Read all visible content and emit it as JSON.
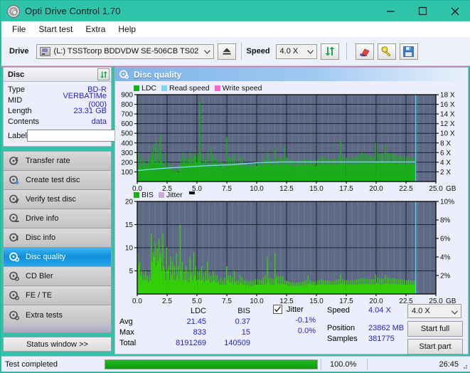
{
  "window": {
    "title": "Opti Drive Control 1.70",
    "icon": "disc-icon",
    "minimize": "minimize-icon",
    "maximize": "maximize-icon",
    "close": "close-icon"
  },
  "menu": {
    "items": [
      {
        "label": "File"
      },
      {
        "label": "Start test"
      },
      {
        "label": "Extra"
      },
      {
        "label": "Help"
      }
    ]
  },
  "toolbar": {
    "drive_label": "Drive",
    "drive_value": "(L:)  TSSTcorp BDDVDW SE-506CB TS02",
    "eject_icon": "eject-icon",
    "speed_label": "Speed",
    "speed_value": "4.0 X",
    "refresh_icon": "refresh-icon",
    "erase_icon": "eraser-icon",
    "key_icon": "key-icon",
    "save_icon": "save-icon"
  },
  "disc_panel": {
    "title": "Disc",
    "refresh_icon": "refresh-icon",
    "rows": [
      {
        "key": "Type",
        "value": "BD-R"
      },
      {
        "key": "MID",
        "value": "VERBATIMe (000)"
      },
      {
        "key": "Length",
        "value": "23.31 GB"
      },
      {
        "key": "Contents",
        "value": "data"
      }
    ],
    "label_key": "Label",
    "label_value": "",
    "label_placeholder": "",
    "disc_button_icon": "cd-icon"
  },
  "nav": {
    "items": [
      {
        "label": "Transfer rate",
        "icon": "disc-rate-icon",
        "selected": false
      },
      {
        "label": "Create test disc",
        "icon": "disc-create-icon",
        "selected": false
      },
      {
        "label": "Verify test disc",
        "icon": "disc-verify-icon",
        "selected": false
      },
      {
        "label": "Drive info",
        "icon": "drive-info-icon",
        "selected": false
      },
      {
        "label": "Disc info",
        "icon": "disc-info-icon",
        "selected": false
      },
      {
        "label": "Disc quality",
        "icon": "disc-quality-icon",
        "selected": true
      },
      {
        "label": "CD Bler",
        "icon": "cd-bler-icon",
        "selected": false
      },
      {
        "label": "FE / TE",
        "icon": "fe-te-icon",
        "selected": false
      },
      {
        "label": "Extra tests",
        "icon": "extra-tests-icon",
        "selected": false
      }
    ],
    "status_window": "Status window >>"
  },
  "main": {
    "title": "Disc quality",
    "title_icon": "disc-quality-icon"
  },
  "stats": {
    "col_ldc": "LDC",
    "col_bis": "BIS",
    "jitter_label": "Jitter",
    "jitter_checked": true,
    "rows": [
      {
        "name": "Avg",
        "ldc": "21.45",
        "bis": "0.37",
        "jitter": "-0.1%"
      },
      {
        "name": "Max",
        "ldc": "833",
        "bis": "15",
        "jitter": "0.0%"
      },
      {
        "name": "Total",
        "ldc": "8191269",
        "bis": "140509",
        "jitter": ""
      }
    ],
    "speed_label": "Speed",
    "speed_value": "4.04 X",
    "position_label": "Position",
    "position_value": "23862 MB",
    "samples_label": "Samples",
    "samples_value": "381775",
    "speed_select": "4.0 X",
    "start_full": "Start full",
    "start_part": "Start part"
  },
  "statusbar": {
    "text": "Test completed",
    "progress_pct_label": "100.0%",
    "progress_value": 100,
    "elapsed": "26:45"
  },
  "colors": {
    "titlebar": "#2ec4aa",
    "ldc_green": "#17b017",
    "bis_green": "#31d400",
    "read_speed": "#7fd6f0",
    "write_speed": "#ff66cc",
    "jitter": "#c9a8d8",
    "plot_bg": "#5e6a85",
    "value_blue": "#2323d0",
    "selection_blue": "#0d8fdc",
    "progress_green": "#12a312"
  },
  "chart_data": [
    {
      "type": "bar",
      "id": "ldc-chart",
      "title": "",
      "xlabel": "GB",
      "ylabel": "",
      "xlim": [
        0.0,
        25.0
      ],
      "ylim": [
        0,
        900
      ],
      "y2lim": [
        0,
        18
      ],
      "y2label": "X",
      "grid": true,
      "legend_position": "top-left",
      "legend": [
        {
          "name": "LDC",
          "color": "#17b017"
        },
        {
          "name": "Read speed",
          "color": "#7fd6f0"
        },
        {
          "name": "Write speed",
          "color": "#ff66cc"
        }
      ],
      "xticks": [
        "0.0",
        "2.5",
        "5.0",
        "7.5",
        "10.0",
        "12.5",
        "15.0",
        "17.5",
        "20.0",
        "22.5",
        "25.0"
      ],
      "yticks": [
        "100",
        "200",
        "300",
        "400",
        "500",
        "600",
        "700",
        "800",
        "900"
      ],
      "y2ticks": [
        "2 X",
        "4 X",
        "6 X",
        "8 X",
        "10 X",
        "12 X",
        "14 X",
        "16 X",
        "18 X"
      ],
      "data_end_gb": 23.31,
      "series": [
        {
          "name": "LDC",
          "color": "#17b017",
          "type": "bar",
          "baseline": 60,
          "values": [
            120,
            300,
            170,
            260,
            140,
            210,
            160,
            230,
            150,
            195,
            175,
            240,
            165,
            205,
            300,
            260,
            370,
            230,
            180,
            420,
            200,
            350,
            195,
            490,
            300,
            210,
            165,
            185,
            150,
            300,
            140,
            195,
            130,
            175,
            120,
            165,
            110,
            150,
            105,
            140,
            100,
            130,
            95,
            125,
            180,
            230,
            170,
            300,
            200,
            260,
            190,
            240,
            185,
            230,
            300,
            200,
            240,
            180,
            270,
            290,
            250,
            200,
            300,
            235,
            830,
            300,
            200,
            180,
            240,
            175,
            230,
            165,
            300,
            170,
            200,
            160,
            360,
            190,
            290,
            175,
            250,
            165,
            230,
            160,
            215,
            155,
            205,
            150,
            200,
            150,
            195,
            145,
            460,
            180,
            260,
            170,
            250,
            165,
            235,
            160,
            290,
            170,
            200,
            160,
            200,
            155,
            260,
            165,
            250,
            160,
            190,
            155,
            185,
            150,
            180,
            150,
            175,
            150,
            175,
            150,
            190,
            155,
            200,
            160,
            210,
            165,
            195,
            160,
            200,
            160,
            230,
            165,
            250,
            170,
            300,
            175,
            230,
            165,
            220,
            160,
            215,
            160,
            360,
            180,
            250,
            170,
            240,
            165,
            240,
            165,
            245,
            168,
            370,
            180,
            250,
            170,
            230,
            165,
            225,
            163,
            220,
            160,
            215,
            160,
            210,
            160,
            215,
            160,
            220,
            162,
            225,
            165,
            230,
            168,
            235,
            170,
            230,
            168,
            225,
            165,
            220,
            163,
            215,
            162,
            220,
            164,
            230,
            168,
            240,
            172,
            260,
            180,
            250,
            175,
            245,
            172,
            240,
            170,
            235,
            168,
            230,
            166,
            230,
            166,
            235,
            168,
            240,
            170,
            270,
            185,
            420,
            200,
            260,
            180,
            250,
            175,
            245,
            173,
            240,
            172,
            240,
            172,
            245,
            174,
            250,
            176,
            260,
            180,
            270,
            185,
            280,
            190,
            300,
            200,
            290,
            195,
            280,
            190,
            275,
            188,
            270,
            186,
            265,
            184,
            260,
            182,
            400,
            210,
            300,
            195,
            290,
            192,
            285,
            190,
            280,
            188,
            380,
            205,
            300,
            195,
            295,
            193,
            290,
            192,
            285,
            190,
            280,
            188,
            275,
            186,
            270,
            184,
            265,
            182,
            260,
            180,
            260,
            180,
            255,
            178,
            255,
            178,
            250,
            176,
            250,
            176,
            245,
            175
          ]
        },
        {
          "name": "Read speed",
          "color": "#7fd6f0",
          "type": "line",
          "unit": "X",
          "points": [
            {
              "x": 0.0,
              "y": 2.3
            },
            {
              "x": 1.0,
              "y": 2.5
            },
            {
              "x": 2.5,
              "y": 2.8
            },
            {
              "x": 4.0,
              "y": 3.0
            },
            {
              "x": 6.0,
              "y": 3.3
            },
            {
              "x": 8.0,
              "y": 3.5
            },
            {
              "x": 10.0,
              "y": 3.9
            },
            {
              "x": 12.0,
              "y": 4.05
            },
            {
              "x": 16.0,
              "y": 4.05
            },
            {
              "x": 20.0,
              "y": 4.05
            },
            {
              "x": 23.3,
              "y": 4.05
            }
          ]
        }
      ],
      "cursor_x": 23.31
    },
    {
      "type": "bar",
      "id": "bis-chart",
      "title": "",
      "xlabel": "GB",
      "ylabel": "",
      "xlim": [
        0.0,
        25.0
      ],
      "ylim": [
        0,
        20
      ],
      "y2lim": [
        0,
        10
      ],
      "y2label": "%",
      "grid": true,
      "legend_position": "top-left",
      "legend": [
        {
          "name": "BIS",
          "color": "#17b017"
        },
        {
          "name": "Jitter",
          "color": "#c9a8d8"
        }
      ],
      "xticks": [
        "0.0",
        "2.5",
        "5.0",
        "7.5",
        "10.0",
        "12.5",
        "15.0",
        "17.5",
        "20.0",
        "22.5",
        "25.0"
      ],
      "yticks": [
        "5",
        "10",
        "15",
        "20"
      ],
      "y2ticks": [
        "2%",
        "4%",
        "6%",
        "8%",
        "10%"
      ],
      "data_end_gb": 23.31,
      "series": [
        {
          "name": "BIS",
          "color": "#31d400",
          "type": "bar",
          "baseline": 1.2,
          "values": [
            9,
            6,
            7,
            4,
            5,
            3,
            4,
            3,
            5,
            3,
            4,
            2.5,
            4,
            3,
            13,
            7,
            9,
            8,
            11,
            6,
            10,
            7,
            12,
            8,
            9,
            5,
            13,
            6,
            5,
            3,
            10,
            5,
            6,
            3,
            8,
            4,
            7,
            3,
            6,
            3,
            9,
            4,
            6,
            3,
            15,
            5,
            7,
            3,
            5,
            3,
            6,
            3,
            5,
            2.5,
            8,
            4,
            5,
            3,
            9,
            4,
            6,
            3,
            5,
            3,
            5,
            3,
            6,
            3,
            4,
            2.5,
            5,
            3,
            7,
            3,
            4,
            2.5,
            4,
            2.5,
            5,
            3,
            4,
            2.5,
            4,
            2.5,
            3,
            2,
            3.5,
            2,
            3,
            2,
            3.5,
            2,
            6,
            3,
            4,
            2.5,
            4,
            2.5,
            3.5,
            2,
            5,
            2.5,
            3,
            2,
            3,
            2,
            4,
            2.5,
            3.5,
            2,
            3,
            2,
            3,
            2,
            2.8,
            1.8,
            2.8,
            1.8,
            2.8,
            1.8,
            3,
            2,
            3.2,
            2,
            3.2,
            2,
            3,
            2,
            3,
            2,
            3.5,
            2,
            4,
            2.2,
            8,
            3,
            3.5,
            2,
            3.4,
            2,
            3.3,
            2,
            9,
            3.2,
            4,
            2.2,
            3.8,
            2.1,
            3.8,
            2.1,
            3.8,
            2.1,
            3,
            2,
            2.8,
            1.9,
            2.7,
            1.8,
            2.6,
            1.8,
            2.5,
            1.8,
            2.5,
            1.8,
            2.5,
            1.8,
            2.5,
            1.8,
            2.6,
            1.8,
            2.7,
            1.9,
            2.8,
            1.9,
            2.9,
            2,
            4,
            2.2,
            3,
            2,
            2.8,
            1.9,
            2.7,
            1.9,
            2.8,
            1.9,
            2.9,
            2,
            3,
            2,
            3.2,
            2.1,
            3,
            2,
            3,
            2,
            2.9,
            2,
            2.9,
            2,
            2.8,
            2,
            2.8,
            2,
            2.9,
            2,
            3,
            2,
            3.2,
            2.1,
            4.3,
            2.4,
            3.2,
            2.1,
            3,
            2,
            3,
            2,
            2.9,
            2,
            2.9,
            2,
            3,
            2,
            3,
            2,
            3.1,
            2,
            3.2,
            2.1,
            3.3,
            2.1,
            3.5,
            2.2,
            3.4,
            2.2,
            3.3,
            2.1,
            3.3,
            2.1,
            3.2,
            2.1,
            3.2,
            2.1,
            3.1,
            2,
            4.2,
            2.4,
            3.5,
            2.2,
            3.4,
            2.1,
            3.4,
            2.1,
            3.3,
            2.1,
            4.1,
            2.3,
            3.5,
            2.2,
            3.5,
            2.2,
            3.4,
            2.1,
            3.4,
            2.1,
            3.3,
            2.1,
            3.3,
            2.1,
            3.2,
            2.1,
            3.2,
            2.1,
            3.1,
            2,
            3.1,
            2,
            3,
            2,
            3,
            2,
            3,
            2,
            2.9,
            2,
            2.9,
            2
          ]
        }
      ],
      "cursor_x": 23.31
    }
  ]
}
